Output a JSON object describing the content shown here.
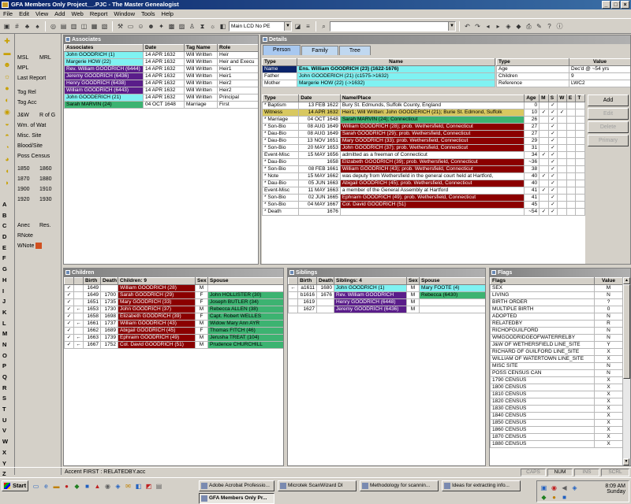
{
  "window": {
    "title": "GFA Members Only Project__.PJC - The Master Genealogist",
    "min": "_",
    "max": "□",
    "close": "×"
  },
  "menu": [
    "File",
    "Edit",
    "View",
    "Add",
    "Web",
    "Report",
    "Window",
    "Tools",
    "Help"
  ],
  "toolbar": {
    "layout_combo": "Main LCD No PE",
    "search_combo": ""
  },
  "sidebar": {
    "links": [
      "MSL",
      "MRL",
      "MPL",
      "Last Report",
      "Tog Rel",
      "Tog Acc",
      "J&W",
      "R of G",
      "Wm. of Wat",
      "Misc. Site",
      "Blood/Site",
      "Poss Census",
      "1850",
      "1860",
      "1870",
      "1880",
      "1900",
      "1910",
      "1920",
      "1930",
      "Anec",
      "Res.",
      "RNote",
      "WNote"
    ],
    "letters": [
      "A",
      "B",
      "C",
      "D",
      "E",
      "F",
      "G",
      "H",
      "I",
      "J",
      "K",
      "L",
      "M",
      "N",
      "O",
      "P",
      "Q",
      "R",
      "S",
      "T",
      "U",
      "V",
      "W",
      "X",
      "Y",
      "Z"
    ]
  },
  "associates": {
    "title": "Associates",
    "headers": [
      "Associates",
      "Date",
      "Tag Name",
      "Role"
    ],
    "rows": [
      [
        "John GOODRICH (1)",
        "14 APR 1632",
        "Will Written",
        "Heir"
      ],
      [
        "Margerie HOW (22)",
        "14 APR 1632",
        "Will Written",
        "Heir and Execu"
      ],
      [
        "Rev. William GOODRICH (6444)",
        "14 APR 1632",
        "Will Written",
        "Heir1"
      ],
      [
        "Jeremy GOODRICH (6436)",
        "14 APR 1632",
        "Will Written",
        "Heir1"
      ],
      [
        "Henry GOODRICH (6438)",
        "14 APR 1632",
        "Will Written",
        "Heir2"
      ],
      [
        "William GOODRICH (6443)",
        "14 APR 1632",
        "Will Written",
        "Heir2"
      ],
      [
        "John GOODERICH (21)",
        "14 APR 1632",
        "Will Written",
        "Principal"
      ],
      [
        "Sarah MARVIN (24)",
        "04 OCT 1648",
        "Marriage",
        "First"
      ]
    ]
  },
  "details": {
    "title": "Details",
    "tabs": [
      "Person",
      "Family",
      "Tree"
    ],
    "name_headers": [
      "Type",
      "Name"
    ],
    "names": [
      [
        "Name",
        "Ens. William GOODRICH (23)  (1622-1676)"
      ],
      [
        "Father",
        "John GOODERICH (21)  (c1575->1632)"
      ],
      [
        "Mother",
        "Margerie HOW (22)  (->1632)"
      ]
    ],
    "flag_headers": [
      "Type",
      "Value"
    ],
    "flags": [
      [
        "Age",
        "Dec'd @ ~54 yrs"
      ],
      [
        "Children",
        "9"
      ],
      [
        "Reference",
        "LWC2"
      ]
    ],
    "event_headers": [
      "Type",
      "Date",
      "Name/Place",
      "Age",
      "M",
      "S",
      "W",
      "E",
      "T"
    ],
    "events": [
      [
        "* Baptism",
        "13 FEB 1622",
        "Bury St. Edmunds, Suffolk County, England",
        "0",
        "",
        "✓",
        ""
      ],
      [
        "Witness",
        "14 APR 1632",
        "Heir1; Will Written: John GOODERICH (21); Burie St. Edmond, Suffolk",
        "10",
        "✓",
        "✓",
        "✓"
      ],
      [
        "* Marriage",
        "04 OCT 1648",
        "Sarah MARVIN (24); Connecticut",
        "26",
        "",
        "✓",
        ""
      ],
      [
        "* Son-Bio",
        "08 AUG 1649",
        "William GOODRICH (28); prob. Wethersfield, Connecticut",
        "27",
        "",
        "✓",
        ""
      ],
      [
        "* Dau-Bio",
        "08 AUG 1649",
        "Sarah GOODRICH (29); prob. Wethersfield, Connecticut",
        "27",
        "",
        "✓",
        ""
      ],
      [
        "* Dau-Bio",
        "13 NOV 1651",
        "Mary GOODRICH (33); prob. Wethersfield, Connecticut",
        "29",
        "",
        "✓",
        ""
      ],
      [
        "* Son-Bio",
        "20 MAY 1653",
        "John GOODRICH (37); prob. Wethersfield, Connecticut",
        "31",
        "",
        "✓",
        ""
      ],
      [
        "Event-Misc",
        "15 MAY 1656",
        "admitted as a freeman of Connecticut",
        "34",
        "✓",
        "✓",
        ""
      ],
      [
        "* Dau-Bio",
        "1658",
        "Elizabeth GOODRICH (39); prob. Wethersfield, Connecticut",
        "~36",
        "",
        "✓",
        ""
      ],
      [
        "* Son-Bio",
        "08 FEB 1661",
        "William GOODRICH (43); prob. Wethersfield, Connecticut",
        "38",
        "",
        "✓",
        ""
      ],
      [
        "* Note",
        "15 MAY 1662",
        "was deputy from Wethersfield in the general court held at Hartford,",
        "40",
        "✓",
        "✓",
        ""
      ],
      [
        "* Dau-Bio",
        "05 JUN 1663",
        "Abigail GOODRICH (45); prob. Wethersfield, Connecticut",
        "40",
        "",
        "✓",
        ""
      ],
      [
        "Event-Misc",
        "11 MAY 1663",
        "a member of the General Assembly at Hartford",
        "41",
        "✓",
        "✓",
        ""
      ],
      [
        "* Son-Bio",
        "02 JUN 1665",
        "Ephraim GOODRICH (49); prob. Wethersfield, Connecticut",
        "41",
        "",
        "✓",
        ""
      ],
      [
        "* Son-Bio",
        "04 MAY 1667",
        "Col. David GOODRICH (51)",
        "45",
        "",
        "✓",
        ""
      ],
      [
        "* Death",
        "1676",
        "",
        "~54",
        "✓",
        "✓",
        ""
      ]
    ],
    "buttons": [
      "Add",
      "Edit",
      "Delete",
      "Primary"
    ]
  },
  "children": {
    "title": "Children",
    "headers": [
      "",
      "",
      "Birth",
      "Death",
      "Children: 9",
      "Sex",
      "Spouse"
    ],
    "rows": [
      [
        "✓",
        "",
        "1649",
        "",
        "William GOODRICH (28)",
        "M",
        ""
      ],
      [
        "✓",
        "",
        "1649",
        "1700",
        "Sarah GOODRICH (29)",
        "F",
        "John HOLLISTER (30)"
      ],
      [
        "✓",
        "",
        "1651",
        "1735",
        "Mary GOODRICH (33)",
        "F",
        "Joseph BUTLER (34)"
      ],
      [
        "✓",
        "←",
        "1653",
        "1730",
        "John GOODRICH (37)",
        "M",
        "Rebecca ALLEN (38)"
      ],
      [
        "✓",
        "",
        "1658",
        "1698",
        "Elizabeth GOODRICH (39)",
        "F",
        "Capt. Robert WELLES"
      ],
      [
        "✓",
        "←",
        "1661",
        "1737",
        "William GOODRICH (43)",
        "M",
        "Widow Mary Ann AYR"
      ],
      [
        "✓",
        "",
        "1662",
        "1689",
        "Abigail GOODRICH (45)",
        "F",
        "Thomas FITCH (46)"
      ],
      [
        "✓",
        "←",
        "1663",
        "1739",
        "Ephraim GOODRICH (49)",
        "M",
        "Jerusha TREAT (104)"
      ],
      [
        "✓",
        "←",
        "1667",
        "1752",
        "Col. David GOODRICH (51)",
        "M",
        "Prudence CHURCHILL"
      ]
    ]
  },
  "siblings": {
    "title": "Siblings",
    "headers": [
      "",
      "Birth",
      "Death",
      "Siblings: 4",
      "Sex",
      "Spouse"
    ],
    "rows": [
      [
        "←",
        "a1611",
        "1680",
        "John GOODRICH (1)",
        "M",
        "Mary FOOTE (4)"
      ],
      [
        "",
        "b1616",
        "1676",
        "Rev. William GOODRICH",
        "M",
        "Rebecca (6430)"
      ],
      [
        "",
        "1619",
        "",
        "Henry GOODRICH (6448)",
        "M",
        ""
      ],
      [
        "",
        "1627",
        "",
        "Jeremy GOODRICH (6436)",
        "M",
        ""
      ]
    ]
  },
  "flags": {
    "title": "Flags",
    "headers": [
      "Flags",
      "Value"
    ],
    "rows": [
      [
        "SEX",
        "M"
      ],
      [
        "LIVING",
        "N"
      ],
      [
        "BIRTH ORDER",
        "?"
      ],
      [
        "MULTIPLE BIRTH",
        "0"
      ],
      [
        "ADOPTED",
        "N"
      ],
      [
        "RELATEDBY",
        "R"
      ],
      [
        "RICHOFGUILFORD",
        "N"
      ],
      [
        "WMGOODRIDGEOFWATERRELBY",
        "N"
      ],
      [
        "J&W OF WETHERSFIELD LINE_SITE",
        "Y"
      ],
      [
        "RICHARD OF GUILFORD LINE_SITE",
        "X"
      ],
      [
        "WILLIAM OF WATERTOWN LINE_SITE",
        "X"
      ],
      [
        "MISC SITE",
        "N"
      ],
      [
        "POSS CENSUS CAN",
        "N"
      ],
      [
        "1790 CENSUS",
        "X"
      ],
      [
        "1800 CENSUS",
        "X"
      ],
      [
        "1810 CENSUS",
        "X"
      ],
      [
        "1820 CENSUS",
        "X"
      ],
      [
        "1830 CENSUS",
        "X"
      ],
      [
        "1840 CENSUS",
        "X"
      ],
      [
        "1850 CENSUS",
        "X"
      ],
      [
        "1860 CENSUS",
        "X"
      ],
      [
        "1870 CENSUS",
        "X"
      ],
      [
        "1880 CENSUS",
        "X"
      ]
    ]
  },
  "statusbar": {
    "text": "Accent FIRST : RELATEDBY.acc",
    "caps": "CAPS",
    "num": "NUM",
    "ins": "INS",
    "scrl": "SCRL"
  },
  "taskbar": {
    "start": "Start",
    "tasks": [
      "Adobe Acrobat Professio...",
      "Microtek ScanWizard DI",
      "Methodology for scannin...",
      "Ideas for extracting info...",
      "GFA Members Only Pr..."
    ],
    "time": "8:09 AM",
    "day": "Sunday"
  }
}
